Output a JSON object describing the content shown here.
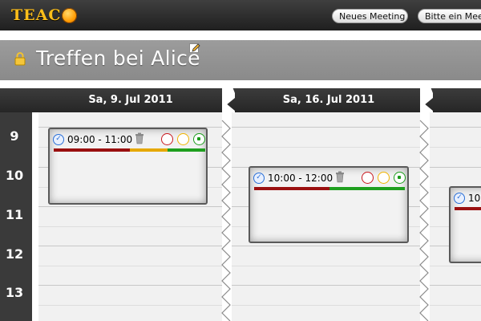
{
  "header": {
    "logo_text": "TEAC",
    "buttons": [
      {
        "label": "Neues Meeting"
      },
      {
        "label": "Bitte ein Meeting"
      }
    ]
  },
  "page": {
    "title": "Treffen bei Alice"
  },
  "calendar": {
    "days": [
      {
        "label": "Sa, 9. Jul 2011"
      },
      {
        "label": "Sa, 16. Jul 2011"
      }
    ],
    "hours": [
      "9",
      "10",
      "11",
      "12",
      "13"
    ],
    "meetings": [
      {
        "time": "09:00 - 11:00",
        "bar_colors": [
          "#9a1010",
          "#e6a800",
          "#1f9f1f"
        ],
        "bar_fractions": [
          0.5,
          0.25,
          0.25
        ]
      },
      {
        "time": "10:00 - 12:00",
        "bar_colors": [
          "#9a1010",
          "#1f9f1f"
        ],
        "bar_fractions": [
          0.5,
          0.5
        ]
      },
      {
        "time": "10:",
        "bar_colors": [
          "#9a1010"
        ],
        "bar_fractions": [
          1.0
        ]
      }
    ]
  },
  "colors": {
    "logo_accent": "#ffbf1a",
    "no": "#c8171d",
    "maybe": "#f0b400",
    "yes": "#1a9c1a"
  }
}
